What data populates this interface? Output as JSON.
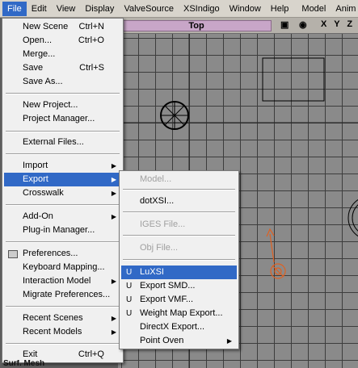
{
  "menubar": {
    "items": [
      "File",
      "Edit",
      "View",
      "Display",
      "ValveSource",
      "XSIndigo",
      "Window",
      "Help",
      "Model",
      "Anim"
    ]
  },
  "viewport": {
    "title": "Top",
    "axes": "X Y Z"
  },
  "file_menu": {
    "items": [
      {
        "label": "New Scene",
        "shortcut": "Ctrl+N"
      },
      {
        "label": "Open...",
        "shortcut": "Ctrl+O"
      },
      {
        "label": "Merge...",
        "shortcut": ""
      },
      {
        "label": "Save",
        "shortcut": "Ctrl+S"
      },
      {
        "label": "Save As...",
        "shortcut": ""
      },
      {
        "label": "New Project...",
        "shortcut": ""
      },
      {
        "label": "Project Manager...",
        "shortcut": ""
      },
      {
        "label": "External Files...",
        "shortcut": ""
      },
      {
        "label": "Import",
        "shortcut": ""
      },
      {
        "label": "Export",
        "shortcut": ""
      },
      {
        "label": "Crosswalk",
        "shortcut": ""
      },
      {
        "label": "Add-On",
        "shortcut": ""
      },
      {
        "label": "Plug-in Manager...",
        "shortcut": ""
      },
      {
        "label": "Preferences...",
        "shortcut": ""
      },
      {
        "label": "Keyboard Mapping...",
        "shortcut": ""
      },
      {
        "label": "Interaction Model",
        "shortcut": ""
      },
      {
        "label": "Migrate Preferences...",
        "shortcut": ""
      },
      {
        "label": "Recent Scenes",
        "shortcut": ""
      },
      {
        "label": "Recent Models",
        "shortcut": ""
      },
      {
        "label": "Exit",
        "shortcut": "Ctrl+Q"
      }
    ]
  },
  "export_menu": {
    "items": [
      {
        "label": "Model..."
      },
      {
        "label": "dotXSI..."
      },
      {
        "label": "IGES File..."
      },
      {
        "label": "Obj File..."
      },
      {
        "label": "LuXSI",
        "icon": "U"
      },
      {
        "label": "Export SMD...",
        "icon": "U"
      },
      {
        "label": "Export VMF...",
        "icon": "U"
      },
      {
        "label": "Weight Map Export...",
        "icon": "U"
      },
      {
        "label": "DirectX Export..."
      },
      {
        "label": "Point Oven"
      }
    ]
  },
  "status": {
    "bottom_label": "Surf. Mesh"
  },
  "colors": {
    "highlight": "#3169c6",
    "menu_bg": "#f0f0f0",
    "viewport_title": "#c8a6c8"
  }
}
